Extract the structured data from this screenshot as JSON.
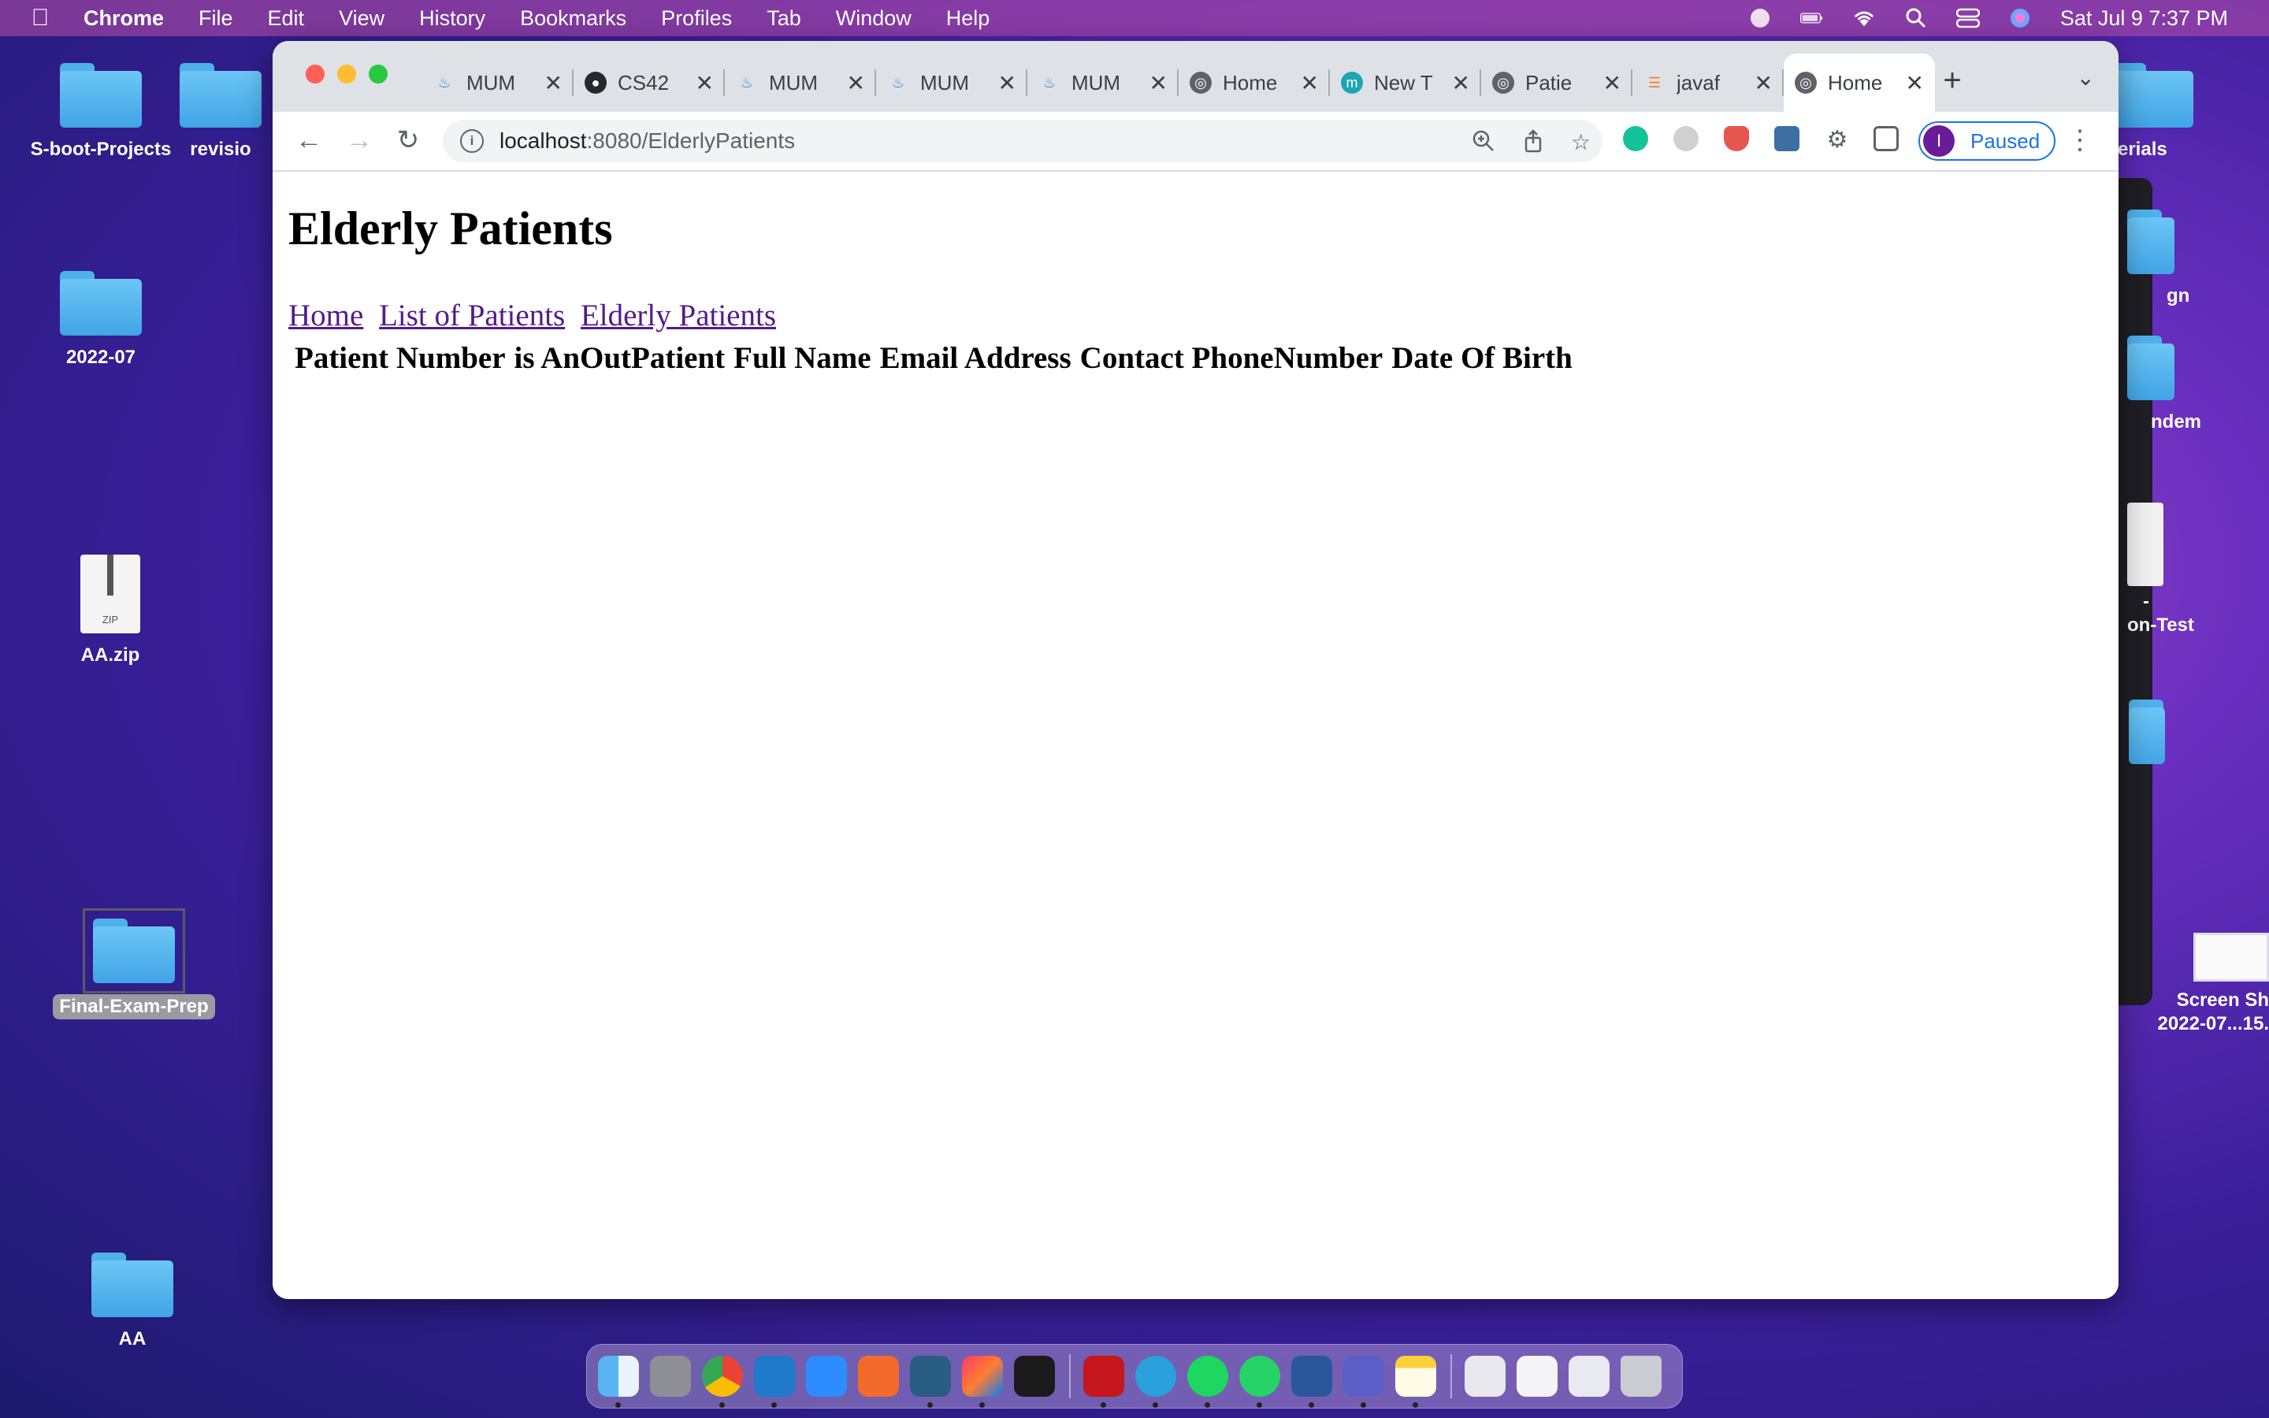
{
  "menubar": {
    "app_name": "Chrome",
    "items": [
      "File",
      "Edit",
      "View",
      "History",
      "Bookmarks",
      "Profiles",
      "Tab",
      "Window",
      "Help"
    ],
    "clock": "Sat Jul 9  7:37 PM"
  },
  "desktop": {
    "icons": [
      {
        "label": "S-boot-Projects",
        "kind": "folder"
      },
      {
        "label": "revisio",
        "kind": "folder"
      },
      {
        "label": "2022-07",
        "kind": "folder"
      },
      {
        "label": "AA.zip",
        "kind": "zip",
        "badge": "ZIP"
      },
      {
        "label": "Final-Exam-Prep",
        "kind": "folder",
        "selected": true
      },
      {
        "label": "AA",
        "kind": "folder"
      },
      {
        "label": "terials",
        "kind": "folder"
      },
      {
        "label": "gn",
        "kind": "folder"
      },
      {
        "label": "ndem",
        "kind": "folder"
      },
      {
        "label": "-",
        "kind": "file"
      },
      {
        "label": "on-Test",
        "kind": "file"
      },
      {
        "label": "Screen Sh",
        "kind": "screenshot"
      },
      {
        "label": "2022-07...15.",
        "kind": "screenshot"
      }
    ]
  },
  "browser": {
    "tabs": [
      {
        "title": "MUM",
        "icon": "java-icon"
      },
      {
        "title": "CS42",
        "icon": "github-icon"
      },
      {
        "title": "MUM",
        "icon": "java-icon"
      },
      {
        "title": "MUM",
        "icon": "java-icon"
      },
      {
        "title": "MUM",
        "icon": "java-icon"
      },
      {
        "title": "Home",
        "icon": "globe-icon"
      },
      {
        "title": "New T",
        "icon": "m-icon"
      },
      {
        "title": "Patie",
        "icon": "globe-icon"
      },
      {
        "title": "javaf",
        "icon": "stackoverflow-icon"
      },
      {
        "title": "Home",
        "icon": "globe-icon",
        "active": true
      }
    ],
    "url_host": "localhost",
    "url_path": ":8080/ElderlyPatients",
    "profile": {
      "initial": "I",
      "label": "Paused"
    }
  },
  "page": {
    "title": "Elderly Patients",
    "nav_links": [
      "Home",
      "List of Patients",
      "Elderly Patients"
    ],
    "table_headers": [
      "Patient Number",
      "is AnOutPatient",
      "Full Name",
      "Email Address",
      "Contact PhoneNumber",
      "Date Of Birth"
    ]
  },
  "colors": {
    "link": "#551a8b",
    "paused_accent": "#1a73e8"
  }
}
